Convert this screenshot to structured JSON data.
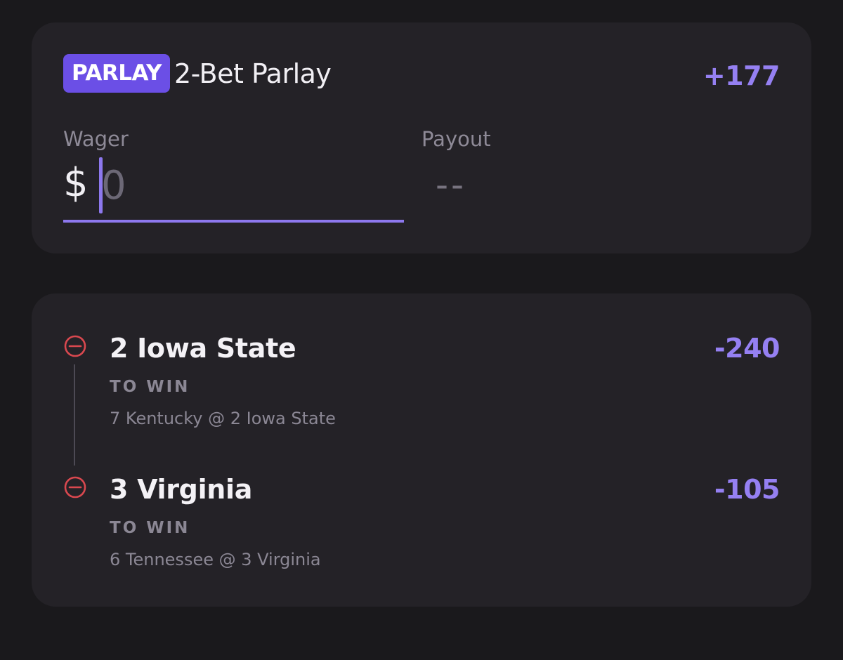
{
  "parlay": {
    "badge": "PARLAY",
    "title": "2-Bet Parlay",
    "odds": "+177"
  },
  "wager": {
    "label": "Wager",
    "currency": "$",
    "placeholder": "0",
    "value": ""
  },
  "payout": {
    "label": "Payout",
    "value": "--"
  },
  "legs": [
    {
      "team": "2 Iowa State",
      "odds": "-240",
      "market": "TO WIN",
      "matchup": "7 Kentucky @ 2 Iowa State"
    },
    {
      "team": "3 Virginia",
      "odds": "-105",
      "market": "TO WIN",
      "matchup": "6 Tennessee @ 3 Virginia"
    }
  ],
  "icons": {
    "remove": "minus-circle-icon"
  },
  "colors": {
    "background": "#1a191c",
    "card": "#242227",
    "accent": "#6b4fe6",
    "odds": "#9580f2",
    "remove": "#d9484f"
  }
}
